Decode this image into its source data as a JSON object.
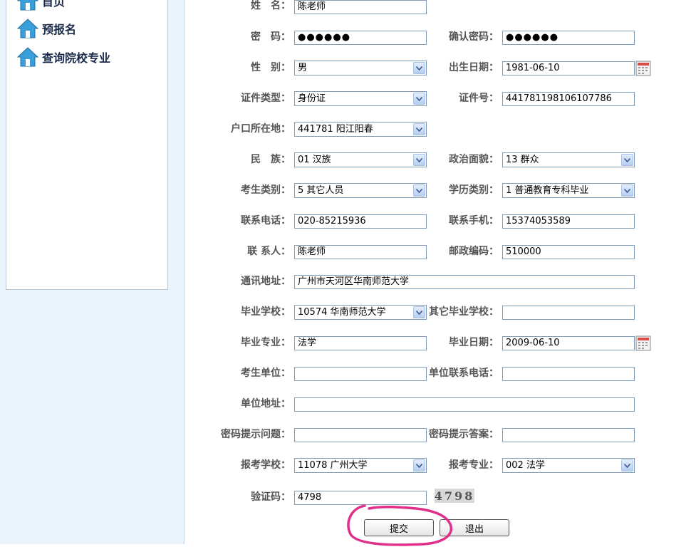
{
  "nav": {
    "items": [
      {
        "label": "首页",
        "icon": "house-icon"
      },
      {
        "label": "预报名",
        "icon": "house-icon"
      },
      {
        "label": "查询院校专业",
        "icon": "house-icon"
      }
    ]
  },
  "form": {
    "name": {
      "label": "姓　名：",
      "value": "陈老师"
    },
    "password": {
      "label": "密　码：",
      "value": "●●●●●●"
    },
    "confirm_password": {
      "label": "确认密码：",
      "value": "●●●●●●"
    },
    "gender": {
      "label": "性　别：",
      "value": "男"
    },
    "birth_date": {
      "label": "出生日期：",
      "value": "1981-06-10"
    },
    "id_type": {
      "label": "证件类型：",
      "value": "身份证"
    },
    "id_number": {
      "label": "证件号：",
      "value": "441781198106107786"
    },
    "household": {
      "label": "户口所在地：",
      "value": "441781 阳江阳春"
    },
    "ethnicity": {
      "label": "民　族：",
      "value": "01 汉族"
    },
    "political_status": {
      "label": "政治面貌：",
      "value": "13 群众"
    },
    "candidate_type": {
      "label": "考生类别：",
      "value": "5 其它人员"
    },
    "education_type": {
      "label": "学历类别：",
      "value": "1 普通教育专科毕业"
    },
    "phone": {
      "label": "联系电话：",
      "value": "020-85215936"
    },
    "mobile": {
      "label": "联系手机：",
      "value": "15374053589"
    },
    "contact_person": {
      "label": "联 系人：",
      "value": "陈老师"
    },
    "postal_code": {
      "label": "邮政编码：",
      "value": "510000"
    },
    "address": {
      "label": "通讯地址：",
      "value": "广州市天河区华南师范大学"
    },
    "graduate_school": {
      "label": "毕业学校：",
      "value": "10574 华南师范大学"
    },
    "other_school": {
      "label": "其它毕业学校：",
      "value": ""
    },
    "graduate_major": {
      "label": "毕业专业：",
      "value": "法学"
    },
    "graduate_date": {
      "label": "毕业日期：",
      "value": "2009-06-10"
    },
    "employer": {
      "label": "考生单位：",
      "value": ""
    },
    "employer_phone": {
      "label": "单位联系电话：",
      "value": ""
    },
    "employer_address": {
      "label": "单位地址：",
      "value": ""
    },
    "security_question": {
      "label": "密码提示问题：",
      "value": ""
    },
    "security_answer": {
      "label": "密码提示答案：",
      "value": ""
    },
    "apply_school": {
      "label": "报考学校：",
      "value": "11078 广州大学"
    },
    "apply_major": {
      "label": "报考专业：",
      "value": "002 法学"
    },
    "captcha_input": {
      "label": "验证码：",
      "value": "4798"
    },
    "captcha_image_text": "4798"
  },
  "buttons": {
    "submit": "提交",
    "exit": "退出"
  },
  "colors": {
    "left_background": "#eaf4fc",
    "field_border": "#7f9db9",
    "annotation": "#e0308a"
  }
}
